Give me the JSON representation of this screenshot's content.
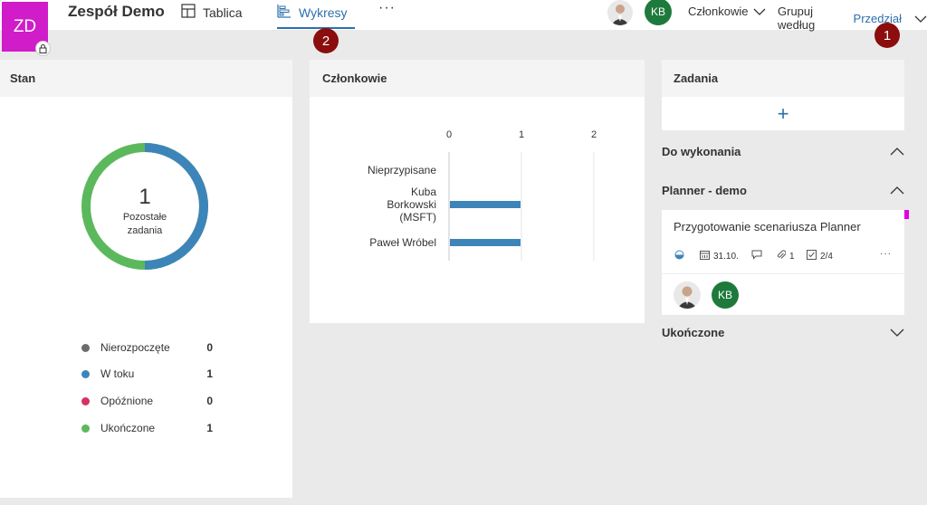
{
  "header": {
    "avatar_initials": "ZD",
    "team_name": "Zespół Demo",
    "tabs": [
      {
        "label": "Tablica"
      },
      {
        "label": "Wykresy"
      }
    ],
    "more": "···",
    "kb_initials": "KB",
    "members_label": "Członkowie",
    "group_by_label": "Grupuj według",
    "group_by_value": "Przedział",
    "badge_1": "1",
    "badge_2": "2"
  },
  "status_panel": {
    "title": "Stan",
    "remaining_count": "1",
    "remaining_label_1": "Pozostałe",
    "remaining_label_2": "zadania",
    "legend": [
      {
        "label": "Nierozpoczęte",
        "count": "0",
        "color": "#6d6d6d"
      },
      {
        "label": "W toku",
        "count": "1",
        "color": "#3d85b8"
      },
      {
        "label": "Opóźnione",
        "count": "0",
        "color": "#d7325f"
      },
      {
        "label": "Ukończone",
        "count": "1",
        "color": "#5cb85c"
      }
    ]
  },
  "members_panel": {
    "title": "Członkowie"
  },
  "chart_data": {
    "type": "bar",
    "orientation": "horizontal",
    "categories": [
      "Nieprzypisane",
      "Kuba Borkowski (MSFT)",
      "Paweł Wróbel"
    ],
    "category_lines": [
      [
        "Nieprzypisane"
      ],
      [
        "Kuba",
        "Borkowski",
        "(MSFT)"
      ],
      [
        "Paweł Wróbel"
      ]
    ],
    "values": [
      0,
      1,
      1
    ],
    "xticks": [
      "0",
      "1",
      "2"
    ],
    "xlim": [
      0,
      2
    ],
    "bar_color": "#3d85b8"
  },
  "tasks_panel": {
    "title": "Zadania",
    "add_symbol": "+",
    "sections": [
      {
        "label": "Do wykonania"
      },
      {
        "label": "Planner - demo"
      },
      {
        "label": "Ukończone"
      }
    ],
    "task": {
      "title": "Przygotowanie scenariusza Planner",
      "due_date": "31.10.",
      "attachments": "1",
      "checklist": "2/4",
      "more": "···",
      "assignee_initials": "KB",
      "label_color": "#e000e0"
    }
  }
}
